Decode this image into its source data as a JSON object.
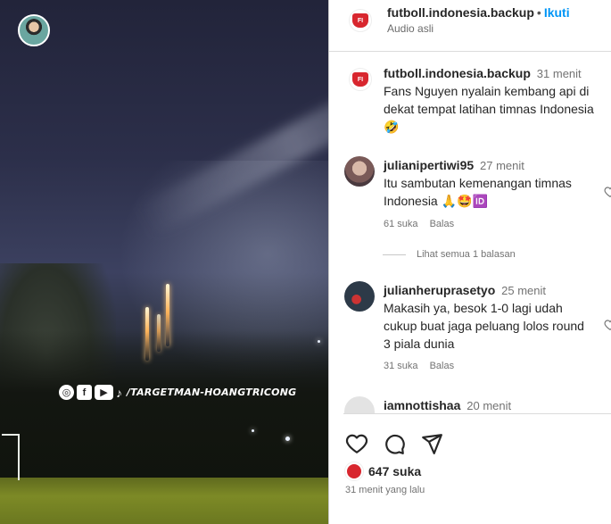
{
  "media": {
    "watermark_text": "/TARGETMAN-HOANGTRICONG",
    "watermark_icons": [
      "instagram-icon",
      "facebook-icon",
      "youtube-icon",
      "tiktok-icon"
    ]
  },
  "header": {
    "username": "futboll.indonesia.backup",
    "separator": "•",
    "follow_label": "Ikuti",
    "audio_label": "Audio asli"
  },
  "caption": {
    "username": "futboll.indonesia.backup",
    "time": "31 menit",
    "text": "Fans Nguyen nyalain kembang api di dekat tempat latihan timnas Indonesia",
    "emoji": "🤣"
  },
  "comments": [
    {
      "username": "julianipertiwi95",
      "time": "27 menit",
      "text": "Itu sambutan kemenangan timnas Indonesia 🙏🤩🆔",
      "likes": "61 suka",
      "reply_label": "Balas",
      "view_replies": "Lihat semua 1 balasan"
    },
    {
      "username": "julianheruprasetyo",
      "time": "25 menit",
      "text": "Makasih ya, besok 1-0 lagi udah cukup buat jaga peluang lolos round 3 piala dunia",
      "likes": "31 suka",
      "reply_label": "Balas"
    },
    {
      "username": "iamnottishaa",
      "time": "20 menit"
    }
  ],
  "footer": {
    "likes": "647 suka",
    "posted": "31 menit yang lalu"
  },
  "colors": {
    "accent": "#0095f6",
    "brand_red": "#d8262e",
    "muted": "#737373"
  }
}
